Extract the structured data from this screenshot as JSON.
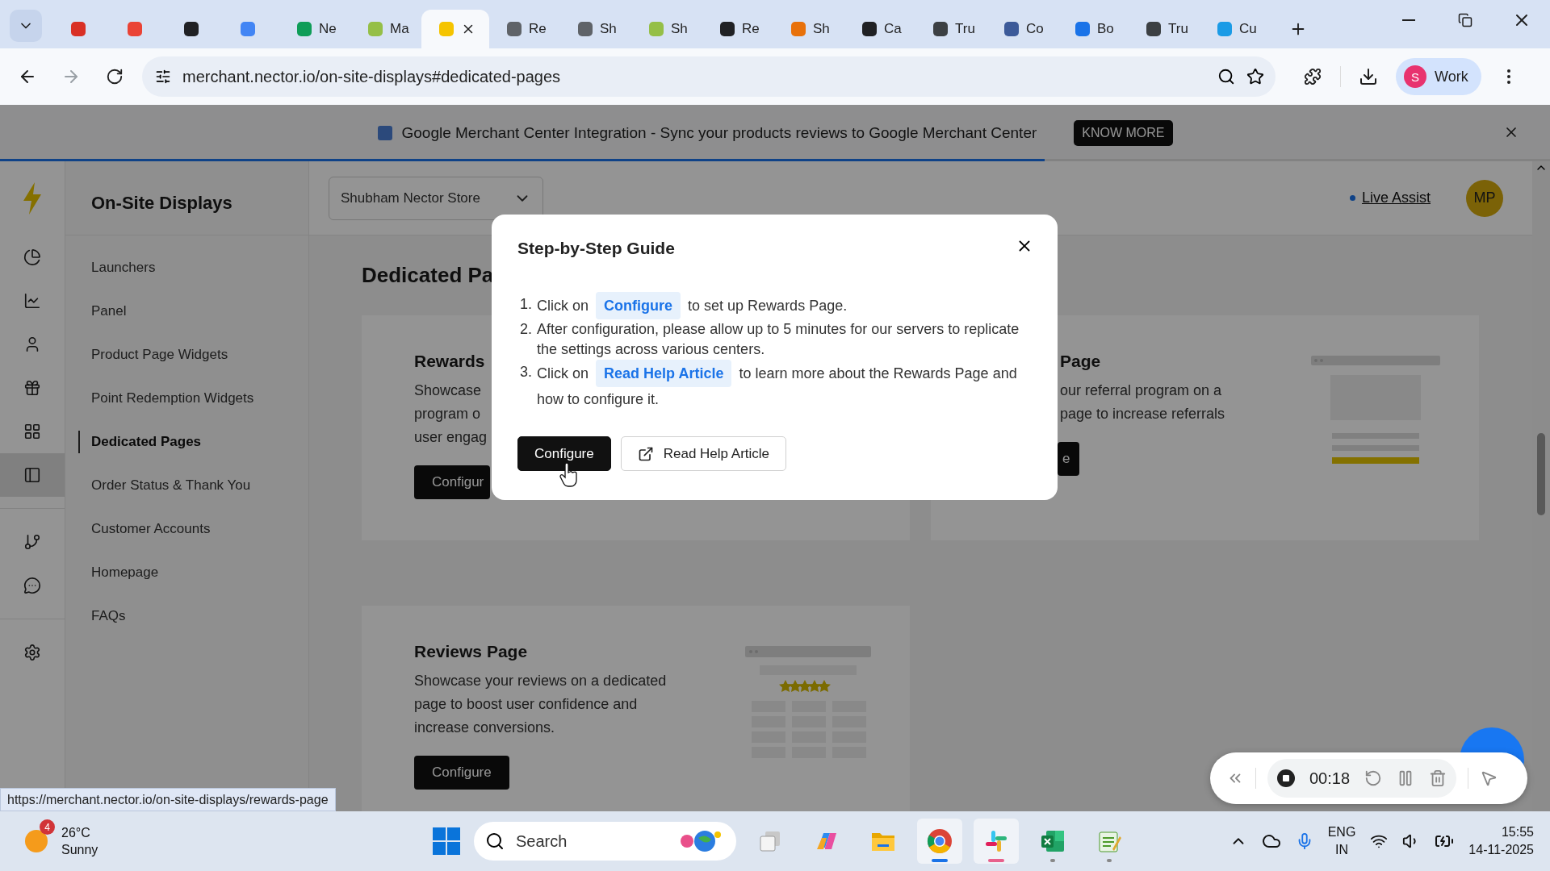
{
  "browser": {
    "tabs": [
      {
        "color": "#d93025",
        "selected": false
      },
      {
        "color": "#ea4335",
        "selected": false
      },
      {
        "color": "#202124",
        "selected": false
      },
      {
        "color": "#4285f4",
        "selected": false
      },
      {
        "label": "Ne",
        "color": "#0f9d58",
        "selected": false
      },
      {
        "label": "Ma",
        "color": "#95bf47",
        "selected": false
      },
      {
        "color": "#f5c400",
        "selected": true
      },
      {
        "label": "Re",
        "color": "#5f6368",
        "selected": false
      },
      {
        "label": "Sh",
        "color": "#5f6368",
        "selected": false
      },
      {
        "label": "Sh",
        "color": "#95bf47",
        "selected": false
      },
      {
        "label": "Re",
        "color": "#202124",
        "selected": false
      },
      {
        "label": "Sh",
        "color": "#e8710a",
        "selected": false
      },
      {
        "label": "Ca",
        "color": "#202124",
        "selected": false
      },
      {
        "label": "Tru",
        "color": "#3c4043",
        "selected": false
      },
      {
        "label": "Co",
        "color": "#3c5a99",
        "selected": false
      },
      {
        "label": "Bo",
        "color": "#1a73e8",
        "selected": false
      },
      {
        "label": "Tru",
        "color": "#3c4043",
        "selected": false
      },
      {
        "label": "Cu",
        "color": "#1a9be6",
        "selected": false
      }
    ],
    "address": "merchant.nector.io/on-site-displays#dedicated-pages",
    "profile": {
      "initial": "S",
      "label": "Work"
    }
  },
  "banner": {
    "text": "Google Merchant Center Integration - Sync your products reviews to Google Merchant Center",
    "button": "KNOW MORE",
    "progress": {
      "level": 0.674
    }
  },
  "rail": {
    "groups": [
      [
        {
          "kind": "pie",
          "selected": false
        },
        {
          "kind": "chart",
          "selected": false
        },
        {
          "kind": "user",
          "selected": false
        },
        {
          "kind": "gift",
          "selected": false
        },
        {
          "kind": "grid",
          "selected": false
        },
        {
          "kind": "panel",
          "selected": true
        }
      ],
      [
        {
          "kind": "branch",
          "selected": false
        },
        {
          "kind": "chat",
          "selected": false
        }
      ],
      [
        {
          "kind": "settings",
          "selected": false
        }
      ]
    ]
  },
  "sidebar": {
    "title": "On-Site Displays",
    "items": [
      {
        "label": "Launchers",
        "selected": false
      },
      {
        "label": "Panel",
        "selected": false
      },
      {
        "label": "Product Page Widgets",
        "selected": false
      },
      {
        "label": "Point Redemption Widgets",
        "selected": false
      },
      {
        "label": "Dedicated Pages",
        "selected": true
      },
      {
        "label": "Order Status & Thank You",
        "selected": false
      },
      {
        "label": "Customer Accounts",
        "selected": false
      },
      {
        "label": "Homepage",
        "selected": false
      },
      {
        "label": "FAQs",
        "selected": false
      }
    ]
  },
  "header": {
    "store": "Shubham Nector Store",
    "live_assist": "Live Assist",
    "avatar": "MP"
  },
  "content": {
    "heading": "Dedicated Pa",
    "cards": [
      {
        "kind": "cut_right",
        "title": "Rewards",
        "lines": [
          "Showcase",
          "program o",
          "user engag"
        ],
        "button": "Configur"
      },
      {
        "kind": "cut_left",
        "title": "Page",
        "lines": [
          "our referral program on a",
          "page to increase referrals"
        ],
        "button": "e"
      },
      {
        "kind": "full",
        "title": "Reviews Page",
        "description": "Showcase your reviews on a dedicated page to boost user confidence and increase conversions.",
        "button": "Configure"
      }
    ]
  },
  "modal": {
    "title": "Step-by-Step Guide",
    "steps": [
      {
        "number": "1.",
        "before": "Click on",
        "chip": "Configure",
        "after": "to set up Rewards Page."
      },
      {
        "number": "2.",
        "text": "After configuration, please allow up to 5 minutes for our servers to replicate the settings across various centers."
      },
      {
        "number": "3.",
        "before": "Click on",
        "chip": "Read Help Article",
        "after": "to learn more about the Rewards Page and how to configure it."
      }
    ],
    "buttons": [
      {
        "kind": "primary",
        "label": "Configure"
      },
      {
        "kind": "secondary",
        "label": "Read Help Article"
      }
    ]
  },
  "recorder": {
    "time": "00:18"
  },
  "status_url": "https://merchant.nector.io/on-site-displays/rewards-page",
  "taskbar": {
    "weather": {
      "badge": "4",
      "temp": "26°C",
      "condition": "Sunny"
    },
    "search": {
      "placeholder": "Search"
    },
    "apps": [
      {
        "kind": "taskview",
        "open": false,
        "selected": false
      },
      {
        "kind": "copilot",
        "open": false,
        "selected": false
      },
      {
        "kind": "folder",
        "open": false,
        "selected": false
      },
      {
        "kind": "browser",
        "open": true,
        "selected": true
      },
      {
        "kind": "slack",
        "open": true,
        "selected": true
      },
      {
        "kind": "sheet",
        "open": true,
        "selected": false
      },
      {
        "kind": "notepad",
        "open": true,
        "selected": false
      }
    ],
    "lang": "ENG",
    "region": "IN",
    "time": "15:55",
    "date": "14-11-2025"
  }
}
